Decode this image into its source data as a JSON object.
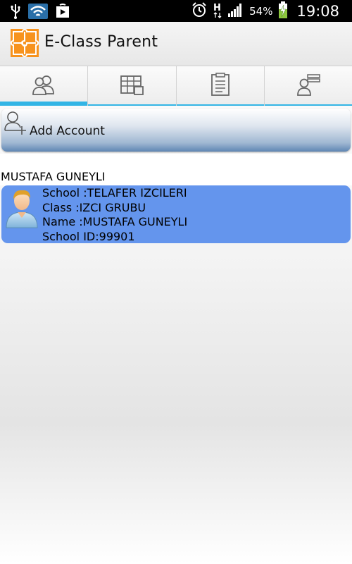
{
  "status_bar": {
    "battery_percent": "54%",
    "clock": "19:08",
    "network_type": "H",
    "icons": [
      "usb-icon",
      "wifi-icon",
      "play-store-icon",
      "alarm-icon",
      "network-h-icon",
      "signal-icon",
      "battery-charging-icon"
    ]
  },
  "app_bar": {
    "title": "E-Class Parent",
    "logo_icon": "puzzle-logo-icon",
    "logo_color": "#f7931e"
  },
  "tabs": [
    {
      "icon": "accounts-icon",
      "active": true
    },
    {
      "icon": "calendar-icon",
      "active": false
    },
    {
      "icon": "clipboard-icon",
      "active": false
    },
    {
      "icon": "user-list-icon",
      "active": false
    }
  ],
  "accent_color": "#33b5e5",
  "add_account": {
    "label": "Add Account",
    "icon": "add-user-icon"
  },
  "students": [
    {
      "header": "MUSTAFA GUNEYLI",
      "school": "School :TELAFER IZCILERI",
      "class": "Class :IZCI GRUBU",
      "name": "Name :MUSTAFA GUNEYLI",
      "school_id": "School ID:99901",
      "card_color": "#6495ed"
    }
  ]
}
